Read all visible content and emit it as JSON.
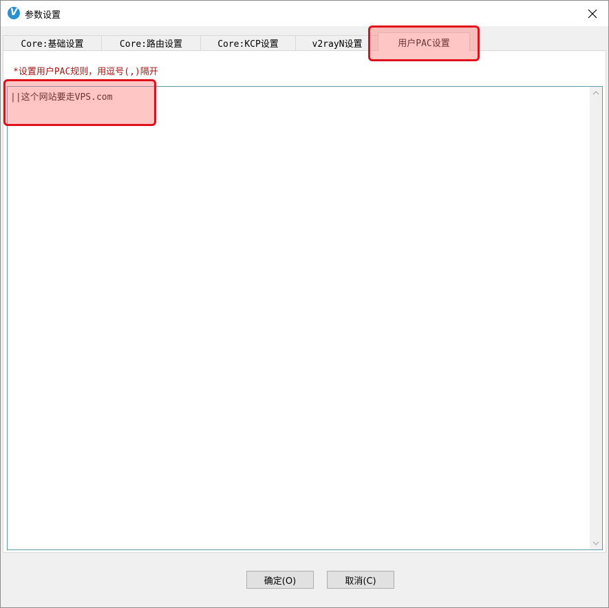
{
  "window": {
    "title": "参数设置",
    "icon": "v2rayn-logo-icon",
    "close_icon": "close-icon"
  },
  "tabs": [
    {
      "label": "Core:基础设置",
      "active": false
    },
    {
      "label": "Core:路由设置",
      "active": false
    },
    {
      "label": "Core:KCP设置",
      "active": false
    },
    {
      "label": "v2rayN设置",
      "active": false
    },
    {
      "label": "用户PAC设置",
      "active": true
    }
  ],
  "pac": {
    "hint": "*设置用户PAC规则，用逗号(,)隔开",
    "rules_value": "||这个网站要走VPS.com"
  },
  "buttons": {
    "ok_label": "确定(O)",
    "cancel_label": "取消(C)"
  },
  "colors": {
    "hint_text": "#a31515",
    "highlight_border": "#e0101a",
    "highlight_fill": "rgba(255,120,120,0.42)",
    "app_icon": "#2b8fd6"
  }
}
